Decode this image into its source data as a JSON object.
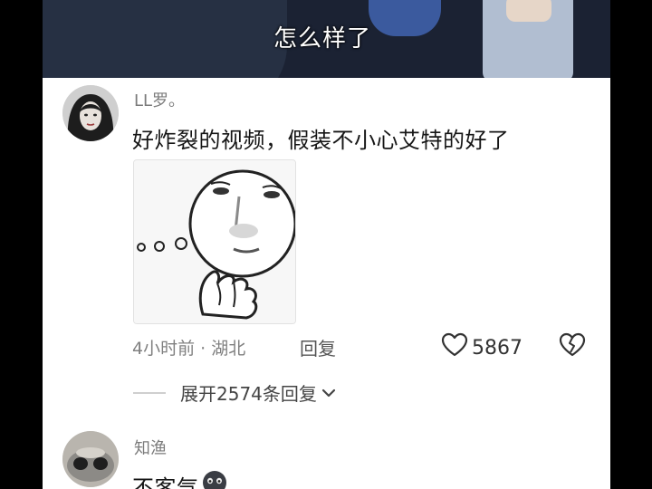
{
  "video": {
    "subtitle": "怎么样了"
  },
  "comments": [
    {
      "username": "LL罗。",
      "text": "好炸裂的视频，假装不小心艾特的好了",
      "meta": "4小时前 · 湖北",
      "reply_label": "回复",
      "likes": "5867",
      "expand_label": "展开2574条回复"
    },
    {
      "username": "知渔",
      "text": "不客气"
    }
  ],
  "icons": {
    "like": "heart-outline-icon",
    "dislike": "broken-heart-icon",
    "expand": "chevron-down-icon"
  }
}
